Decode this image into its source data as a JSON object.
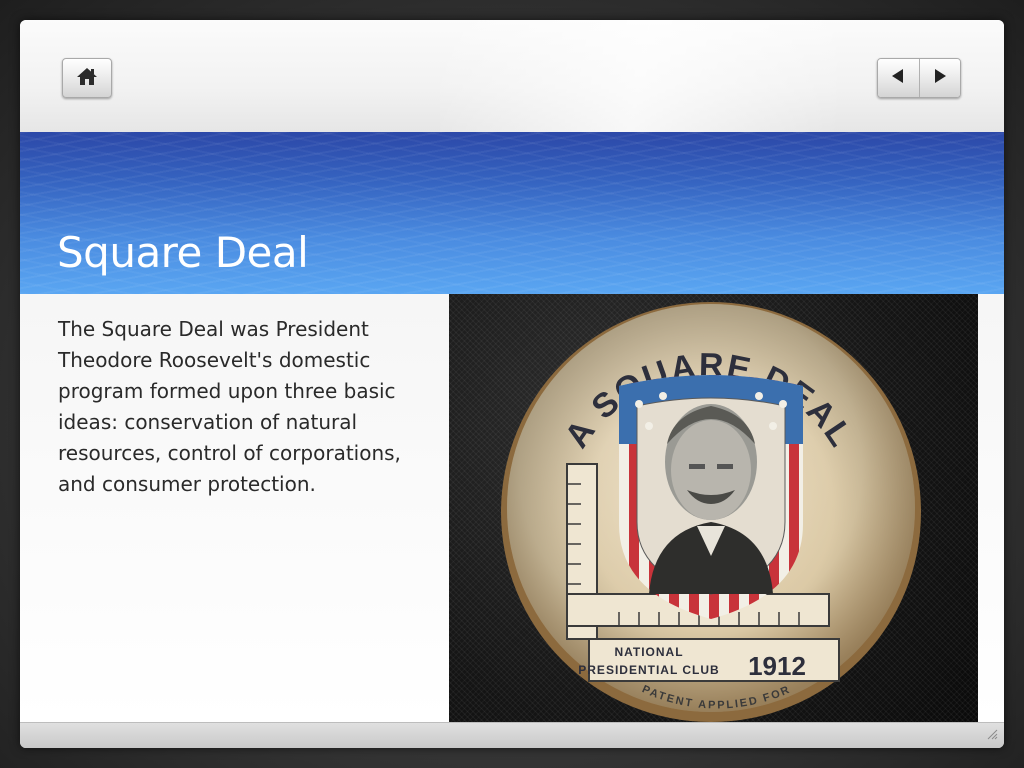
{
  "nav": {
    "home_icon": "home-icon",
    "prev_icon": "triangle-left-icon",
    "next_icon": "triangle-right-icon"
  },
  "slide": {
    "title": "Square Deal",
    "body": "The Square Deal was President Theodore Roosevelt's domestic program formed upon three basic ideas: conservation of natural resources, control of corporations, and consumer protection."
  },
  "image": {
    "button_top_text": "A SQUARE DEAL",
    "banner_line1": "NATIONAL",
    "banner_line2": "PRESIDENTIAL CLUB",
    "year": "1912",
    "bottom_text": "PATENT APPLIED FOR"
  },
  "colors": {
    "title_band_top": "#2c48a8",
    "title_band_bottom": "#5aa6f2",
    "title_text": "#ffffff",
    "body_text": "#2a2a2a"
  }
}
